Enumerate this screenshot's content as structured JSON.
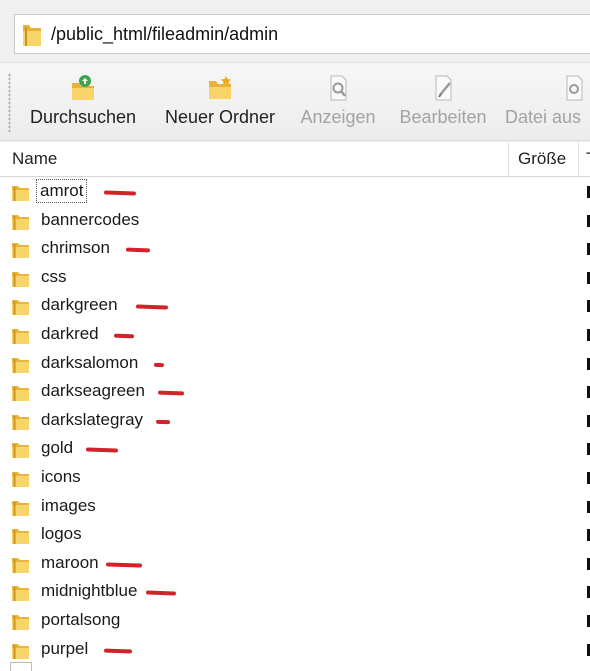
{
  "address": {
    "path": "/public_html/fileadmin/admin",
    "icon": "folder-icon"
  },
  "toolbar": {
    "buttons": [
      {
        "label": "Durchsuchen",
        "icon": "folder-search-icon",
        "enabled": true
      },
      {
        "label": "Neuer Ordner",
        "icon": "new-folder-icon",
        "enabled": true
      },
      {
        "label": "Anzeigen",
        "icon": "view-icon",
        "enabled": false
      },
      {
        "label": "Bearbeiten",
        "icon": "edit-icon",
        "enabled": false
      },
      {
        "label": "Datei aus",
        "icon": "execute-icon",
        "enabled": false
      }
    ]
  },
  "columns": {
    "name": "Name",
    "size": "Größe"
  },
  "folders": [
    {
      "name": "amrot",
      "marked": true
    },
    {
      "name": "bannercodes",
      "marked": false
    },
    {
      "name": "chrimson",
      "marked": true
    },
    {
      "name": "css",
      "marked": false
    },
    {
      "name": "darkgreen",
      "marked": true
    },
    {
      "name": "darkred",
      "marked": true
    },
    {
      "name": "darksalomon",
      "marked": true
    },
    {
      "name": "darkseagreen",
      "marked": true
    },
    {
      "name": "darkslategray",
      "marked": true
    },
    {
      "name": "gold",
      "marked": true
    },
    {
      "name": "icons",
      "marked": false
    },
    {
      "name": "images",
      "marked": false
    },
    {
      "name": "logos",
      "marked": false
    },
    {
      "name": "maroon",
      "marked": true
    },
    {
      "name": "midnightblue",
      "marked": true
    },
    {
      "name": "portalsong",
      "marked": false
    },
    {
      "name": "purpel",
      "marked": true
    }
  ],
  "colors": {
    "folder": "#f5c84c",
    "annotation": "#d2232a"
  }
}
